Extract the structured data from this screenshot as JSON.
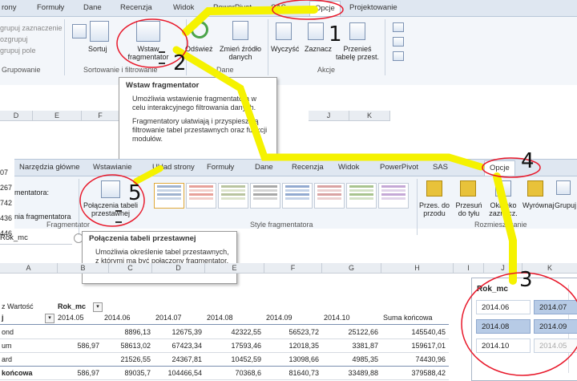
{
  "top_ribbon": {
    "tabs": [
      "rony",
      "Formuły",
      "Dane",
      "Recenzja",
      "Widok",
      "PowerPivot",
      "SAS",
      "Opcje",
      "Projektowanie"
    ],
    "group_items": [
      "grupuj zaznaczenie",
      "ozgrupuj",
      "grupuj pole"
    ],
    "groups": [
      "Grupowanie",
      "Sortowanie i filtrowanie",
      "Dane",
      "Akcje"
    ],
    "sort_label": "Sortuj",
    "insert_slicer_label": "Wstaw fragmentator",
    "refresh_label": "Odśwież",
    "change_source_label": "Zmień źródło danych",
    "clear_label": "Wyczyść",
    "select_label": "Zaznacz",
    "move_label": "Przenieś tabelę przest."
  },
  "tooltip1": {
    "title": "Wstaw fragmentator",
    "line1": "Umożliwia wstawienie fragmentatora w celu interakcyjnego filtrowania danych.",
    "line2": "Fragmentatory ułatwiają i przyspieszają filtrowanie tabel przestawnych oraz funkcji modułów."
  },
  "grid_cols_top": [
    "D",
    "E",
    "F"
  ],
  "grid_cols_top_right": [
    "J",
    "K"
  ],
  "side_values": [
    "07",
    "267",
    "742",
    "436",
    "446"
  ],
  "second_ribbon": {
    "tabs": [
      "Narzędzia główne",
      "Wstawianie",
      "Układ strony",
      "Formuły",
      "Dane",
      "Recenzja",
      "Widok",
      "PowerPivot",
      "SAS",
      "Opcje"
    ],
    "left_lines": [
      "mentatora:",
      "nia fragmentatora"
    ],
    "fragmentator_group": "Fragmentator",
    "connections_label": "Połączenia tabeli przestawnej",
    "styles_group": "Style fragmentatora",
    "arrange_group": "Rozmieszczanie",
    "bring_forward": "Przes. do przodu",
    "send_backward": "Przesuń do tyłu",
    "selection_pane": "Okienko zaznacz.",
    "align": "Wyrównaj",
    "group": "Grupuj"
  },
  "tooltip2": {
    "title": "Połączenia tabeli przestawnej",
    "body": "Umożliwia określenie tabel przestawnych, z którymi ma być połączony fragmentator."
  },
  "name_box": "Rok_mc",
  "grid_cols_bottom": [
    "A",
    "B",
    "C",
    "D",
    "E",
    "F",
    "G",
    "H",
    "I",
    "J",
    "K"
  ],
  "pivot": {
    "value_label": "z Wartość",
    "col_field": "Rok_mc",
    "row_field": "j",
    "columns": [
      "2014.05",
      "2014.06",
      "2014.07",
      "2014.08",
      "2014.09",
      "2014.10",
      "Suma końcowa"
    ],
    "rows": [
      {
        "label": "ond",
        "values": [
          "",
          "8896,13",
          "12675,39",
          "42322,55",
          "56523,72",
          "25122,66",
          "145540,45"
        ]
      },
      {
        "label": "um",
        "values": [
          "586,97",
          "58613,02",
          "67423,34",
          "17593,46",
          "12018,35",
          "3381,87",
          "159617,01"
        ]
      },
      {
        "label": "ard",
        "values": [
          "",
          "21526,55",
          "24367,81",
          "10452,59",
          "13098,66",
          "4985,35",
          "74430,96"
        ]
      },
      {
        "label": "końcowa",
        "values": [
          "586,97",
          "89035,7",
          "104466,54",
          "70368,6",
          "81640,73",
          "33489,88",
          "379588,42"
        ]
      }
    ]
  },
  "slicer": {
    "title": "Rok_mc",
    "items": [
      {
        "label": "2014.06",
        "state": "normal"
      },
      {
        "label": "2014.07",
        "state": "selected"
      },
      {
        "label": "2014.08",
        "state": "selected"
      },
      {
        "label": "2014.09",
        "state": "selected"
      },
      {
        "label": "2014.10",
        "state": "normal"
      },
      {
        "label": "2014.05",
        "state": "dim"
      }
    ]
  },
  "annotations": [
    "1",
    "2",
    "3",
    "4",
    "5"
  ],
  "colors": {
    "arrow": "#f5f200",
    "circle": "#e8182a",
    "slicer_selected": "#b7cbe6",
    "ribbon": "#f1f5fa"
  }
}
